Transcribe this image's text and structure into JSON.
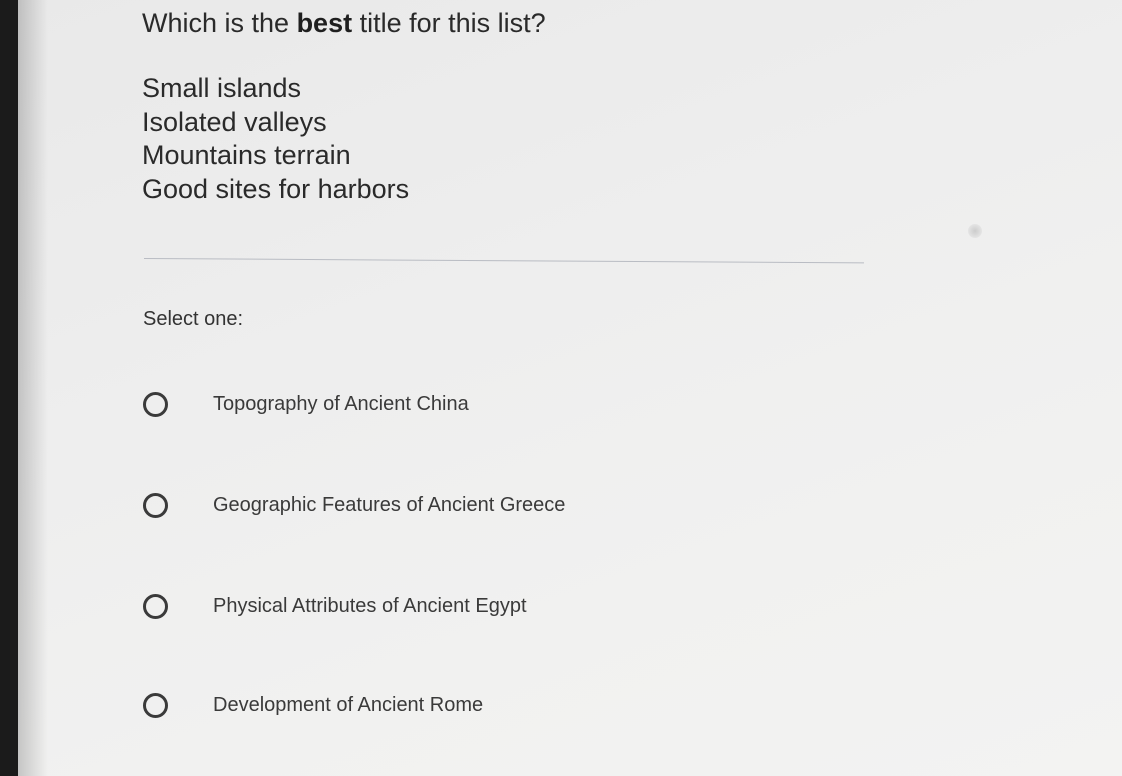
{
  "question": {
    "prefix": "Which is the ",
    "emphasis": "best",
    "suffix": " title for this list?"
  },
  "list_items": [
    "Small islands",
    "Isolated valleys",
    "Mountains terrain",
    "Good sites for harbors"
  ],
  "select_label": "Select one:",
  "options": [
    {
      "label": "Topography of Ancient China",
      "selected": false
    },
    {
      "label": "Geographic Features of Ancient Greece",
      "selected": false
    },
    {
      "label": "Physical Attributes of Ancient Egypt",
      "selected": false
    },
    {
      "label": "Development of Ancient Rome",
      "selected": false
    }
  ]
}
